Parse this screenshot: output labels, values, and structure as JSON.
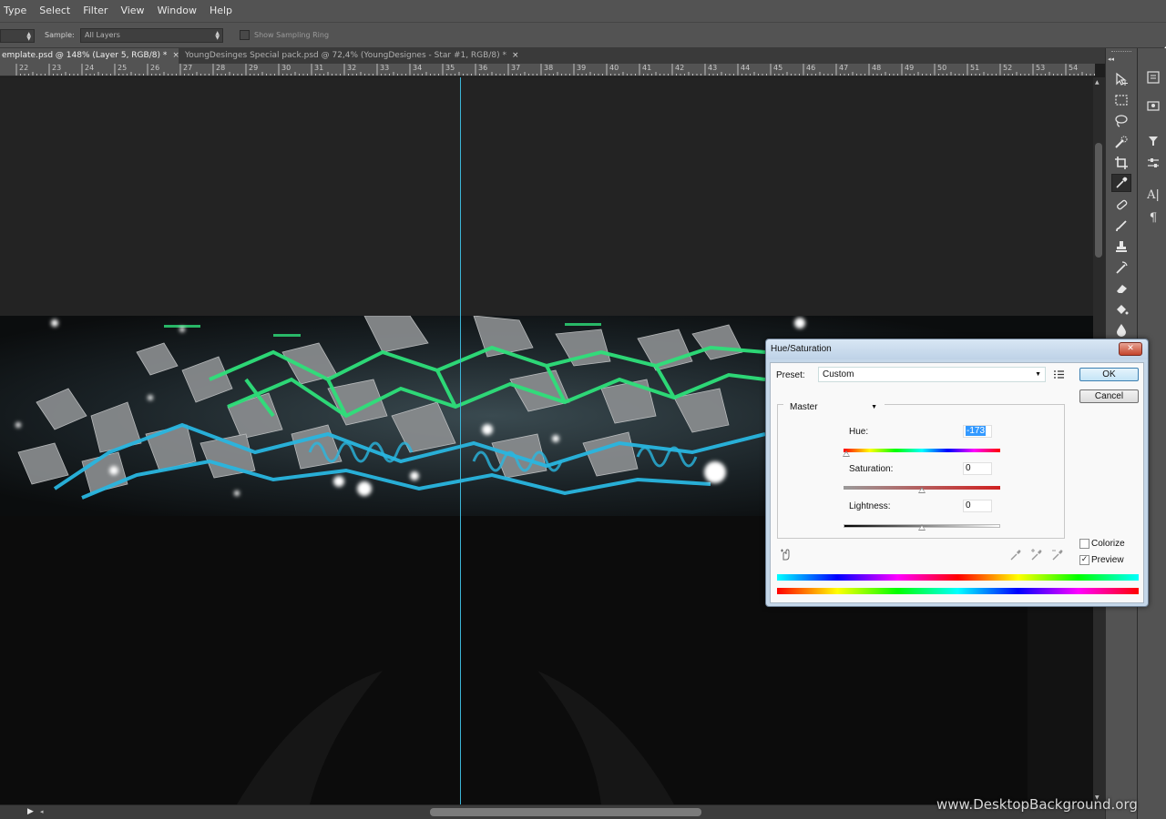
{
  "menu": {
    "items": [
      "Type",
      "Select",
      "Filter",
      "View",
      "Window",
      "Help"
    ]
  },
  "options": {
    "sample_label": "Sample:",
    "sample_value": "All Layers",
    "ring_label": "Show Sampling Ring",
    "ring_checked": false
  },
  "tabs": [
    {
      "label": "emplate.psd @ 148% (Layer 5, RGB/8) *",
      "active": true
    },
    {
      "label": "YoungDesinges Special pack.psd @ 72,4% (YoungDesignes - Star #1, RGB/8) *",
      "active": false
    }
  ],
  "ruler": {
    "labels": [
      "22",
      "23",
      "24",
      "25",
      "26",
      "27",
      "28",
      "29",
      "30",
      "31",
      "32",
      "33",
      "34",
      "35",
      "36",
      "37",
      "38",
      "39",
      "40",
      "41",
      "42",
      "43",
      "44",
      "45",
      "46",
      "47",
      "48",
      "49",
      "50",
      "51",
      "52",
      "53",
      "54"
    ]
  },
  "tools": {
    "icons": [
      "move-tool-icon",
      "marquee-tool-icon",
      "lasso-tool-icon",
      "quick-select-tool-icon",
      "crop-tool-icon",
      "eyedropper-tool-icon",
      "healing-brush-tool-icon",
      "brush-tool-icon",
      "clone-stamp-tool-icon",
      "history-brush-tool-icon",
      "eraser-tool-icon",
      "paint-bucket-tool-icon",
      "blur-tool-icon"
    ],
    "active": "eyedropper-tool-icon"
  },
  "right_panel": {
    "icons": [
      "history-panel-icon",
      "libraries-panel-icon",
      "adjustments-panel-icon",
      "properties-panel-icon",
      "character-panel-icon",
      "paragraph-panel-icon"
    ],
    "character_glyph": "A|",
    "paragraph_glyph": "¶"
  },
  "dialog": {
    "title": "Hue/Saturation",
    "close": "✕",
    "preset_label": "Preset:",
    "preset_value": "Custom",
    "ok": "OK",
    "cancel": "Cancel",
    "channel": "Master",
    "hue_label": "Hue:",
    "hue_value": "-173",
    "hue_level": -173,
    "saturation_label": "Saturation:",
    "saturation_value": "0",
    "lightness_label": "Lightness:",
    "lightness_value": "0",
    "colorize_label": "Colorize",
    "colorize_checked": false,
    "preview_label": "Preview",
    "preview_checked": true,
    "preview_mark": "✓"
  },
  "bottom": {
    "play": "▶",
    "prev": "◂"
  },
  "watermark": "www.DesktopBackground.org",
  "colors": {
    "guide": "#3cb4d6",
    "ui_gray": "#535353",
    "canvas_bg": "#232323",
    "artwork_green": "#2ee07a",
    "artwork_cyan": "#29b6e0"
  }
}
